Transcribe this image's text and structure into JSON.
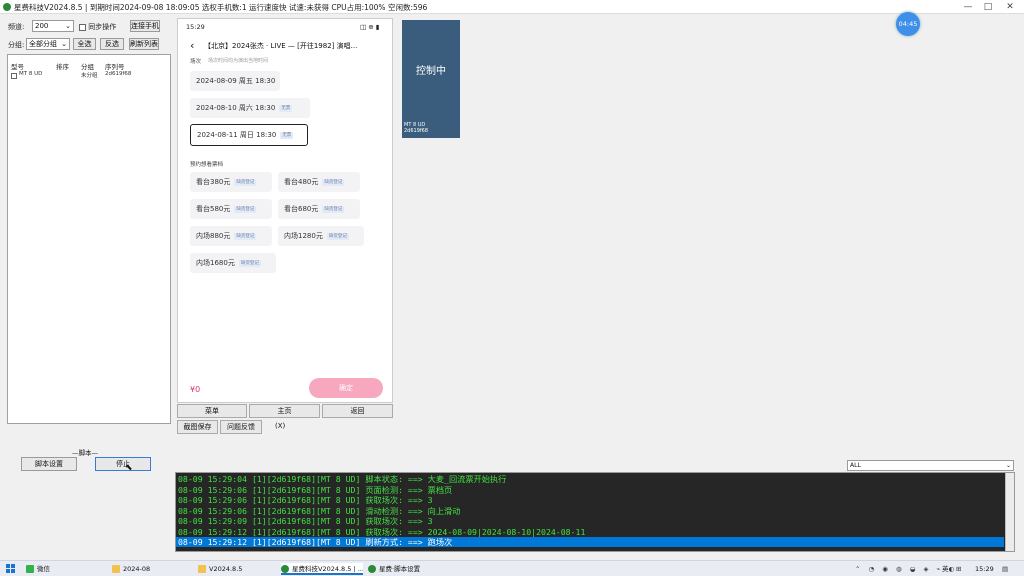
{
  "window": {
    "title": "星费科技V2024.8.5 | 到期时间2024-09-08 18:09:05 选权手机数:1 运行速度快 试速:未获得  CPU占用:100% 空闲数:596",
    "controls": [
      "—",
      "□",
      "✕"
    ]
  },
  "toolbar": {
    "channel_label": "频道:",
    "channel_value": "200",
    "sync_label": "同步操作",
    "connect_btn": "连接手机",
    "group_label": "分组:",
    "group_value": "全部分组",
    "select_all": "全选",
    "invert": "反选",
    "refresh": "刷新列表"
  },
  "device_table": {
    "headers": [
      "型号",
      "排序",
      "分组",
      "序列号"
    ],
    "rows": [
      {
        "model": "MT 8 UD",
        "order": "",
        "group": "未分组",
        "serial": "2d619f68"
      }
    ]
  },
  "script": {
    "section_label": "脚本",
    "settings_btn": "脚本设置",
    "stop_btn": "停止"
  },
  "phone": {
    "time": "15:29",
    "status_icons": "◫ ⊕ ▮",
    "page_title": "【北京】2024张杰 · LIVE — [开往1982] 演唱...",
    "session_label": "场次",
    "session_hint": "场次时间均为演出当地时间",
    "sessions": [
      {
        "text": "2024-08-09 周五 18:30",
        "tag": ""
      },
      {
        "text": "2024-08-10 周六 18:30",
        "tag": "无票"
      },
      {
        "text": "2024-08-11 周日 18:30",
        "tag": "无票"
      }
    ],
    "price_label": "预约想看票档",
    "prices": [
      {
        "text": "看台380元",
        "tag": "缺货登记"
      },
      {
        "text": "看台480元",
        "tag": "缺货登记"
      },
      {
        "text": "看台580元",
        "tag": "缺货登记"
      },
      {
        "text": "看台680元",
        "tag": "缺货登记"
      },
      {
        "text": "内场880元",
        "tag": "缺货登记"
      },
      {
        "text": "内场1280元",
        "tag": "缺货登记"
      },
      {
        "text": "内场1680元",
        "tag": "缺货登记"
      }
    ],
    "price_symbol": "¥0",
    "confirm": "确定"
  },
  "phone_controls": {
    "menu": "菜单",
    "home": "主页",
    "back": "返回",
    "screenshot": "截图保存",
    "problem": "问题反馈",
    "close": "(X)"
  },
  "thumbnail": {
    "label": "控制中",
    "caption_line1": "MT 8 UD",
    "caption_line2": "2d619f68"
  },
  "timer_badge": "04:45",
  "filter": {
    "value": "ALL"
  },
  "log": {
    "lines": [
      "08-09 15:29:04 [1][2d619f68][MT 8 UD] 脚本状态: ==> 大麦_回流票开始执行",
      "08-09 15:29:06 [1][2d619f68][MT 8 UD] 页面检测: ==> 票档页",
      "08-09 15:29:06 [1][2d619f68][MT 8 UD] 获取场次: ==> 3",
      "08-09 15:29:06 [1][2d619f68][MT 8 UD] 滑动检测: ==> 向上滑动",
      "08-09 15:29:09 [1][2d619f68][MT 8 UD] 获取场次: ==> 3",
      "08-09 15:29:12 [1][2d619f68][MT 8 UD] 获取场次: ==> 2024-08-09|2024-08-10|2024-08-11",
      "08-09 15:29:12 [1][2d619f68][MT 8 UD] 刷新方式: ==> 跑场次"
    ]
  },
  "taskbar": {
    "items": [
      "微信",
      "2024-08",
      "V2024.8.5",
      "星费科技V2024.8.5 | ...",
      "星费·脚本设置"
    ],
    "tray": "英",
    "clock": "15:29"
  },
  "colors": {
    "log_bg": "#262626",
    "log_text": "#43e043",
    "highlight": "#0078d7",
    "confirm": "#f7a8bf",
    "badge": "#3d8fe8"
  }
}
